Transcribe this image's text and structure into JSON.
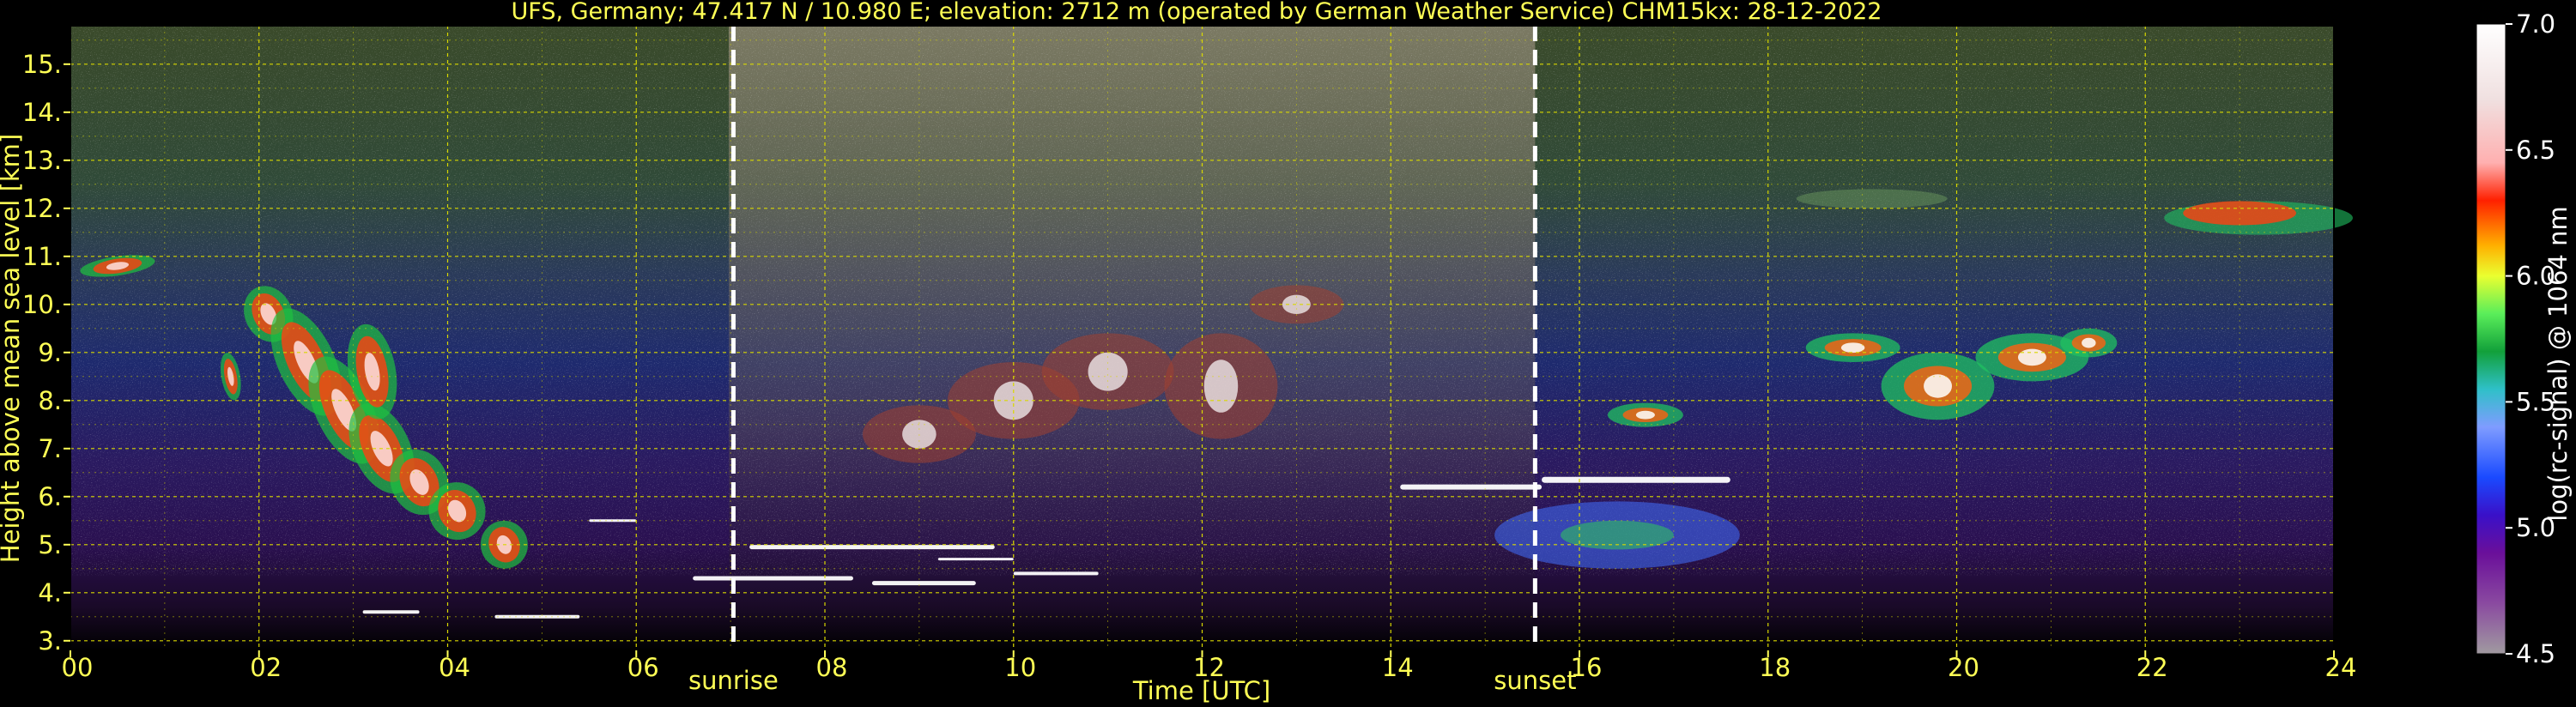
{
  "chart_data": {
    "type": "heatmap",
    "title": "UFS, Germany; 47.417 N / 10.980 E; elevation: 2712 m  (operated by German Weather Service)    CHM15kx: 28-12-2022",
    "xlabel": "Time [UTC]",
    "ylabel": "Height above mean sea level [km]",
    "xlim": [
      0,
      24
    ],
    "ylim": [
      2.8,
      15.8
    ],
    "x_ticks": [
      0,
      2,
      4,
      6,
      8,
      10,
      12,
      14,
      16,
      18,
      20,
      22,
      24
    ],
    "x_tick_labels": [
      "00",
      "02",
      "04",
      "06",
      "08",
      "10",
      "12",
      "14",
      "16",
      "18",
      "20",
      "22",
      "24"
    ],
    "y_ticks": [
      3,
      4,
      5,
      6,
      7,
      8,
      9,
      10,
      11,
      12,
      13,
      14,
      15
    ],
    "y_tick_labels": [
      "3.",
      "4.",
      "5.",
      "6.",
      "7.",
      "8.",
      "9.",
      "10.",
      "11.",
      "12.",
      "13.",
      "14.",
      "15."
    ],
    "y_grid_minor": [
      3.5,
      4.5,
      5.5,
      6.5,
      7.5,
      8.5,
      9.5,
      10.5,
      11.5,
      12.5,
      13.5,
      14.5,
      15.5
    ],
    "grid": true,
    "events": [
      {
        "label": "sunrise",
        "x": 7.03
      },
      {
        "label": "sunset",
        "x": 15.53
      }
    ],
    "colorbar": {
      "label": "log(rc-signal) @ 1064 nm",
      "range": [
        4.5,
        7.0
      ],
      "ticks": [
        4.5,
        5.0,
        5.5,
        6.0,
        6.5,
        7.0
      ],
      "tick_labels": [
        "4.5",
        "5.0",
        "5.5",
        "6.0",
        "6.5",
        "7.0"
      ],
      "stops": [
        {
          "v": 4.5,
          "c": "#a09aa0"
        },
        {
          "v": 4.7,
          "c": "#8a4aa0"
        },
        {
          "v": 4.9,
          "c": "#6a0f9a"
        },
        {
          "v": 5.05,
          "c": "#3a10c8"
        },
        {
          "v": 5.2,
          "c": "#1a4aff"
        },
        {
          "v": 5.4,
          "c": "#7f9cff"
        },
        {
          "v": 5.55,
          "c": "#2fc0c8"
        },
        {
          "v": 5.7,
          "c": "#12a03a"
        },
        {
          "v": 5.85,
          "c": "#5aee5a"
        },
        {
          "v": 6.0,
          "c": "#eaff30"
        },
        {
          "v": 6.12,
          "c": "#ffb000"
        },
        {
          "v": 6.3,
          "c": "#ff2000"
        },
        {
          "v": 6.45,
          "c": "#ffb0b0"
        },
        {
          "v": 6.7,
          "c": "#f0e0e0"
        },
        {
          "v": 7.0,
          "c": "#ffffff"
        }
      ]
    }
  },
  "colors": {
    "text": "#ffff55",
    "grid": "#d8d800",
    "colorbar_text": "#ffffff",
    "background": "#000000"
  }
}
